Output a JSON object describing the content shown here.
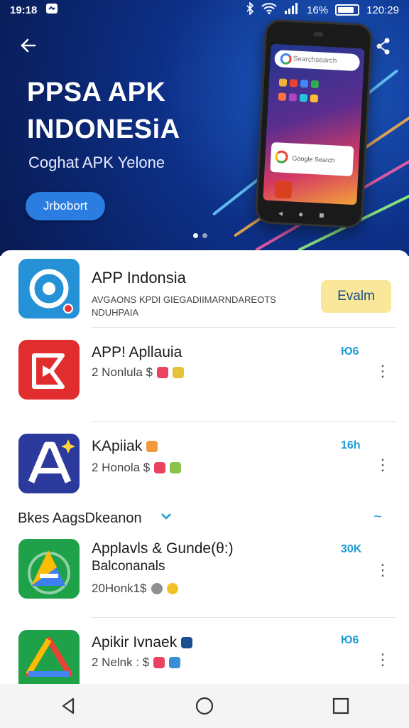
{
  "status_bar": {
    "time_left": "19:18",
    "battery_text": "16%",
    "time_right": "120:29",
    "icons": [
      "notification-icon",
      "bluetooth-icon",
      "wifi-icon",
      "signal-icon",
      "battery-icon"
    ]
  },
  "hero": {
    "title_line1": "PPSA APK",
    "title_line2": "INDONESiA",
    "subtitle": "Coghat APK Yelone",
    "cta_label": "Jrbobort",
    "phone_search_text": "Searchsearch",
    "phone_card_text": "Google Search",
    "slide_count": 2,
    "active_slide": 0
  },
  "apps": [
    {
      "name": "APP Indonsia",
      "meta_line1": "AVGAONS KPDI GIEGADIIMARNDAREOTS",
      "meta_line2": "NDUHPAIA",
      "action_label": "Evalm"
    },
    {
      "name": "APP! Apllauia",
      "meta": "2 Nonlula $",
      "size": "Ю6"
    },
    {
      "name": "KApiiak",
      "meta": "2 Honola $",
      "size": "16h"
    }
  ],
  "section": {
    "title": "Bkes AagsDkeanon",
    "more": "~"
  },
  "apps_section": [
    {
      "name": "Applavls & Gunde(θ:)",
      "name_line2": "Balconanals",
      "meta": "20Honk1$",
      "size": "30K"
    },
    {
      "name": "Apikir Ivnaek",
      "meta": "2 Nelnk : $",
      "size": "Ю6"
    }
  ],
  "colors": {
    "hero_bg": "#0d2f86",
    "accent_blue": "#1e9ad6",
    "install_bg": "#fbe79a",
    "cta_bg": "#2a7de1"
  },
  "navbar": {
    "icons": [
      "back-triangle-icon",
      "home-circle-icon",
      "recents-square-icon"
    ]
  }
}
